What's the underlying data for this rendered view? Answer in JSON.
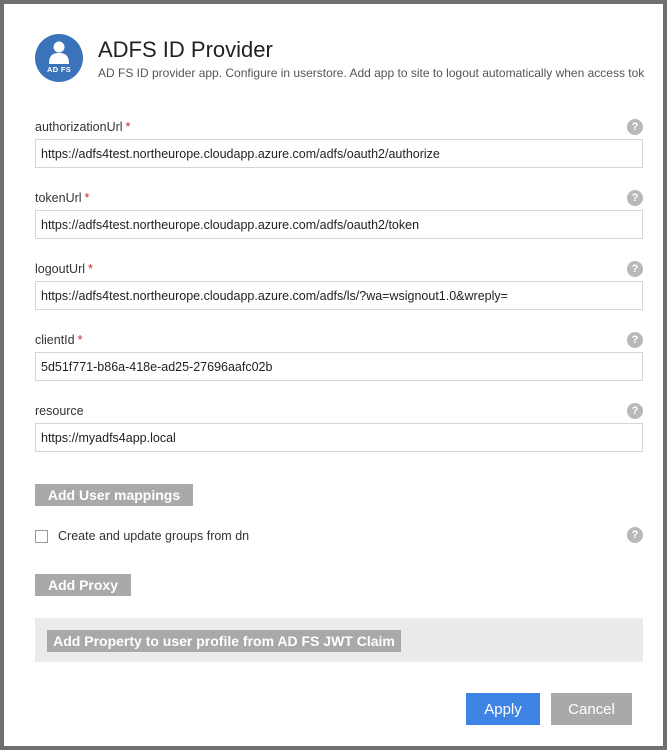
{
  "header": {
    "logo_text": "AD FS",
    "title": "ADFS ID Provider",
    "subtitle": "AD FS ID provider app. Configure in userstore. Add app to site to logout automatically when access tok"
  },
  "fields": [
    {
      "label": "authorizationUrl",
      "required": "*",
      "value": "https://adfs4test.northeurope.cloudapp.azure.com/adfs/oauth2/authorize"
    },
    {
      "label": "tokenUrl",
      "required": "*",
      "value": "https://adfs4test.northeurope.cloudapp.azure.com/adfs/oauth2/token"
    },
    {
      "label": "logoutUrl",
      "required": "*",
      "value": "https://adfs4test.northeurope.cloudapp.azure.com/adfs/ls/?wa=wsignout1.0&wreply="
    },
    {
      "label": "clientId",
      "required": "*",
      "value": "5d51f771-b86a-418e-ad25-27696aafc02b"
    },
    {
      "label": "resource",
      "required": "",
      "value": "https://myadfs4app.local"
    }
  ],
  "help_glyph": "?",
  "buttons": {
    "add_user_mappings": "Add User mappings",
    "add_proxy": "Add Proxy",
    "add_property": "Add Property to user profile from AD FS JWT Claim",
    "apply": "Apply",
    "cancel": "Cancel"
  },
  "checkbox": {
    "label": "Create and update groups from dn",
    "checked": false
  },
  "colors": {
    "accent": "#3e84e5",
    "logo": "#3a73b9",
    "required": "#c62828",
    "secondary_button": "#a9a9a9"
  }
}
